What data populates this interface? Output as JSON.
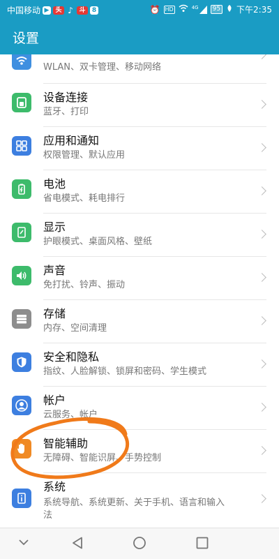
{
  "status_bar": {
    "carrier": "中国移动",
    "time": "下午2:35",
    "battery": "95",
    "hd_label": "HD",
    "network": "4G",
    "app_icons": [
      "hd-video-icon",
      "news-icon",
      "tiktok-icon",
      "app-icon",
      "eight-icon"
    ],
    "right_icons": [
      "alarm-icon",
      "hd-call-icon",
      "wifi-icon",
      "signal-icon",
      "battery-icon",
      "leaf-icon"
    ]
  },
  "header": {
    "title": "设置"
  },
  "items": [
    {
      "title": "",
      "subtitle": "WLAN、双卡管理、移动网络",
      "icon": "wifi-icon",
      "color": "#3f8fe0"
    },
    {
      "title": "设备连接",
      "subtitle": "蓝牙、打印",
      "icon": "device-connect-icon",
      "color": "#3dbb6b"
    },
    {
      "title": "应用和通知",
      "subtitle": "权限管理、默认应用",
      "icon": "apps-icon",
      "color": "#3d7fe0"
    },
    {
      "title": "电池",
      "subtitle": "省电模式、耗电排行",
      "icon": "battery-icon",
      "color": "#3dbb6b"
    },
    {
      "title": "显示",
      "subtitle": "护眼模式、桌面风格、壁纸",
      "icon": "display-icon",
      "color": "#3dbb6b"
    },
    {
      "title": "声音",
      "subtitle": "免打扰、铃声、振动",
      "icon": "sound-icon",
      "color": "#3dbb6b"
    },
    {
      "title": "存储",
      "subtitle": "内存、空间清理",
      "icon": "storage-icon",
      "color": "#8d8d8d"
    },
    {
      "title": "安全和隐私",
      "subtitle": "指纹、人脸解锁、锁屏和密码、学生模式",
      "icon": "shield-icon",
      "color": "#3d7fe0"
    },
    {
      "title": "帐户",
      "subtitle": "云服务、帐户",
      "icon": "account-icon",
      "color": "#3d7fe0"
    },
    {
      "title": "智能辅助",
      "subtitle": "无障碍、智能识屏、手势控制",
      "icon": "hand-icon",
      "color": "#f08a24"
    },
    {
      "title": "系统",
      "subtitle": "系统导航、系统更新、关于手机、语言和输入",
      "subtitle2": "法",
      "icon": "system-icon",
      "color": "#3d7fe0"
    }
  ],
  "annotation": {
    "color": "#f07a1a",
    "target": "智能辅助"
  },
  "nav": {
    "icons": [
      "chevron-down-icon",
      "back-icon",
      "home-icon",
      "recents-icon"
    ]
  }
}
